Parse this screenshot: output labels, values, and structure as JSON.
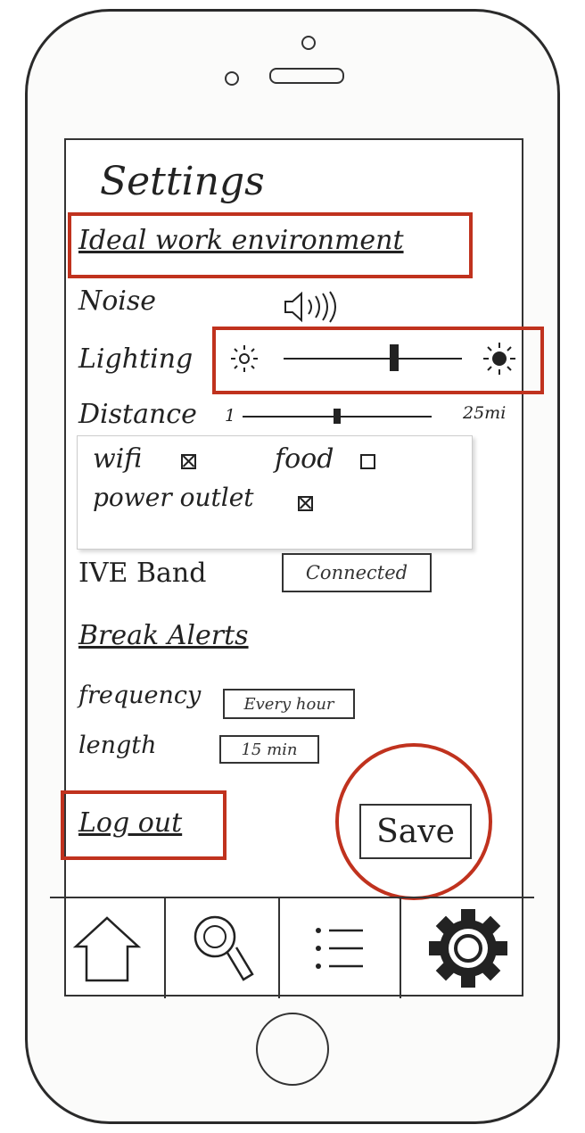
{
  "screen_title": "Settings",
  "ideal_section": {
    "heading": "Ideal work environment",
    "noise_label": "Noise",
    "lighting_label": "Lighting",
    "lighting_level": 0.62,
    "distance_label": "Distance",
    "distance_min": "1",
    "distance_max": "25mi",
    "distance_level": 0.5
  },
  "amenities": {
    "wifi_label": "wifi",
    "wifi_checked": true,
    "food_label": "food",
    "food_checked": false,
    "power_label": "power outlet",
    "power_checked": true
  },
  "band": {
    "label": "IVE Band",
    "status": "Connected"
  },
  "break_alerts": {
    "heading": "Break Alerts",
    "frequency_label": "frequency",
    "frequency_value": "Every hour",
    "length_label": "length",
    "length_value": "15 min"
  },
  "actions": {
    "logout_label": "Log out",
    "save_label": "Save"
  },
  "tabbar": {
    "items": [
      "home-icon",
      "search-icon",
      "list-icon",
      "gear-icon"
    ]
  },
  "colors": {
    "highlight": "#c0321e",
    "ink": "#222222"
  }
}
